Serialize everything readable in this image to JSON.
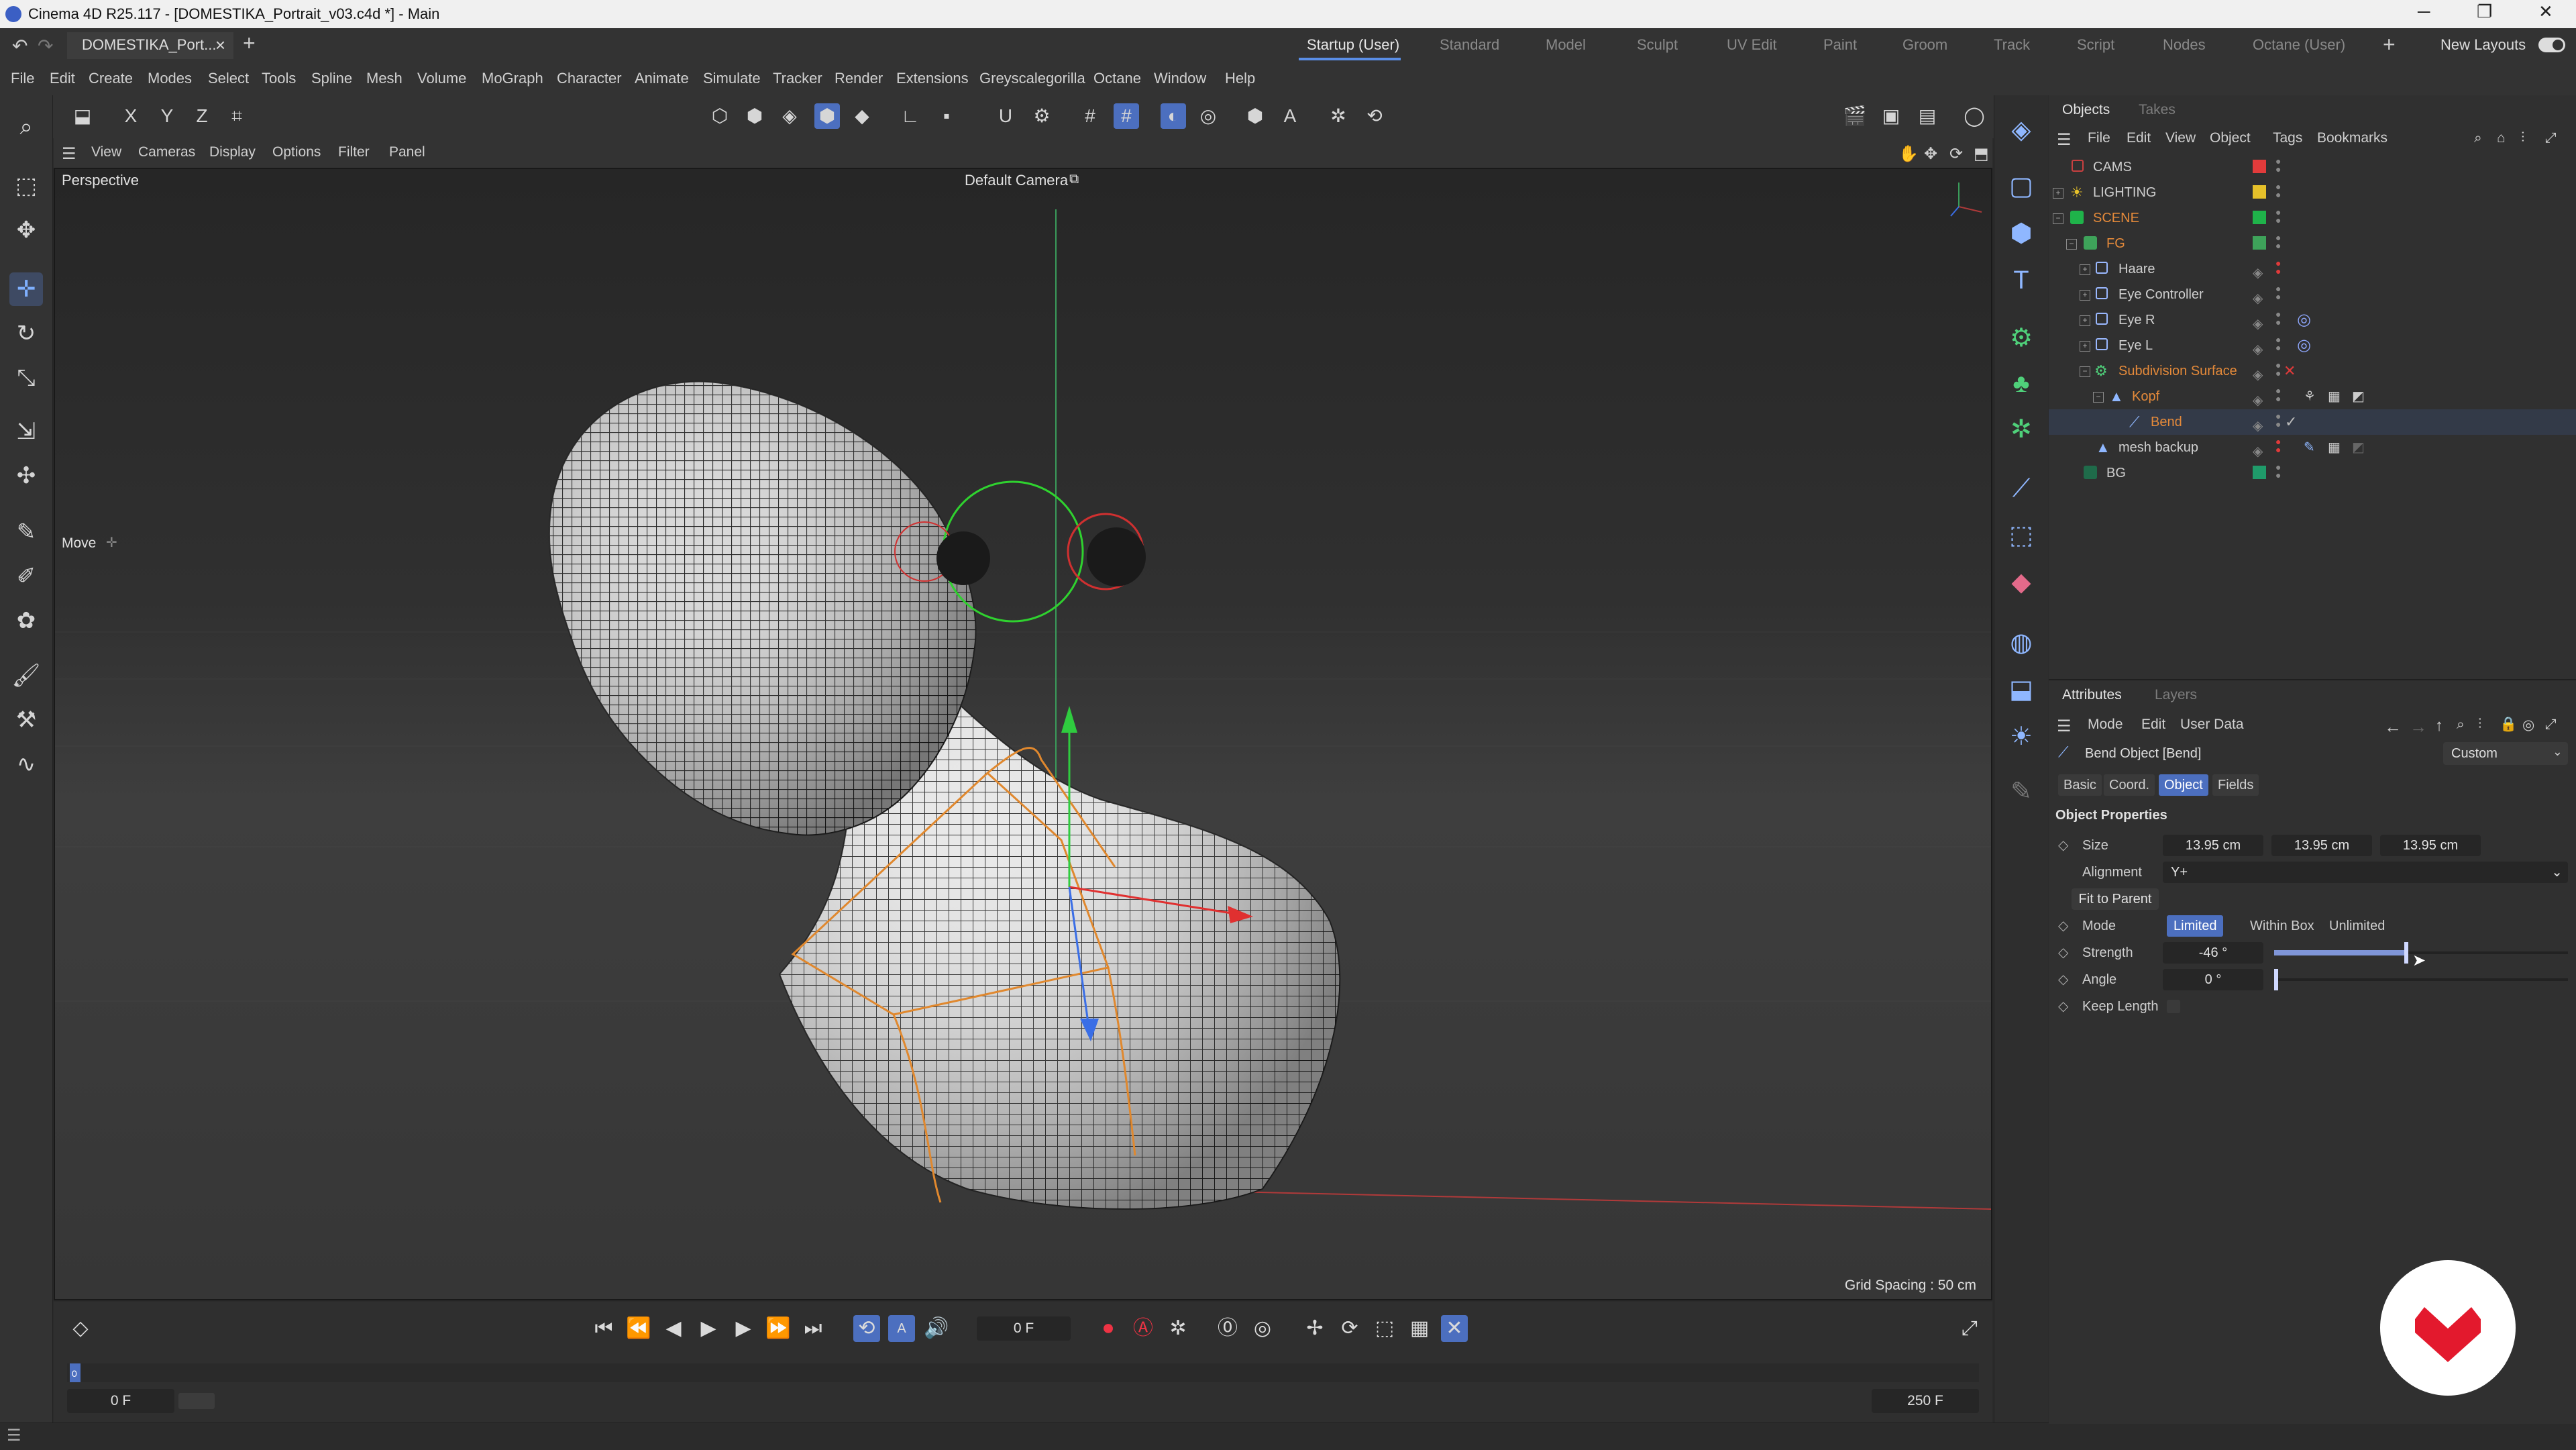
{
  "window": {
    "title": "Cinema 4D R25.117 - [DOMESTIKA_Portrait_v03.c4d *] - Main"
  },
  "doc_tab": {
    "label": "DOMESTIKA_Port...",
    "close": "×",
    "add": "+"
  },
  "layouts": [
    {
      "label": "Startup (User)",
      "active": true
    },
    {
      "label": "Standard"
    },
    {
      "label": "Model"
    },
    {
      "label": "Sculpt"
    },
    {
      "label": "UV Edit"
    },
    {
      "label": "Paint"
    },
    {
      "label": "Groom"
    },
    {
      "label": "Track"
    },
    {
      "label": "Script"
    },
    {
      "label": "Nodes"
    },
    {
      "label": "Octane (User)"
    }
  ],
  "new_layouts": "New Layouts",
  "menu": [
    "File",
    "Edit",
    "Create",
    "Modes",
    "Select",
    "Tools",
    "Spline",
    "Mesh",
    "Volume",
    "MoGraph",
    "Character",
    "Animate",
    "Simulate",
    "Tracker",
    "Render",
    "Extensions",
    "Greyscalegorilla",
    "Octane",
    "Window",
    "Help"
  ],
  "axis_lock": {
    "x": "X",
    "y": "Y",
    "z": "Z"
  },
  "viewport_menu": [
    "View",
    "Cameras",
    "Display",
    "Options",
    "Filter",
    "Panel"
  ],
  "viewport": {
    "label": "Perspective",
    "camera": "Default Camera",
    "grid_spacing": "Grid Spacing : 50 cm",
    "tool_hud": "Move"
  },
  "timeline": {
    "current_frame": "0 F",
    "start_frame": "0 F",
    "end_frame": "250 F",
    "playhead_marker": "0"
  },
  "objects_panel": {
    "tabs": [
      {
        "label": "Objects",
        "active": true
      },
      {
        "label": "Takes"
      }
    ],
    "menu": [
      "File",
      "Edit",
      "View",
      "Object",
      "Tags",
      "Bookmarks"
    ],
    "rows": [
      {
        "name": "CAMS",
        "color": "#e23b3b"
      },
      {
        "name": "LIGHTING",
        "color": "#e6c12a"
      },
      {
        "name": "SCENE",
        "color": "#1fb34a",
        "text_color": "#e58a3a"
      },
      {
        "name": "FG",
        "color": "#3ea35a",
        "text_color": "#e58a3a"
      },
      {
        "name": "Haare"
      },
      {
        "name": "Eye Controller"
      },
      {
        "name": "Eye R"
      },
      {
        "name": "Eye L"
      },
      {
        "name": "Subdivision Surface",
        "text_color": "#e58a3a"
      },
      {
        "name": "Kopf",
        "text_color": "#e58a3a"
      },
      {
        "name": "Bend",
        "text_color": "#e58a3a"
      },
      {
        "name": "mesh backup"
      },
      {
        "name": "BG",
        "color": "#1f9b6a"
      }
    ]
  },
  "attributes_panel": {
    "tabs": [
      {
        "label": "Attributes",
        "active": true
      },
      {
        "label": "Layers"
      }
    ],
    "menu": [
      "Mode",
      "Edit",
      "User Data"
    ],
    "object_title": "Bend Object [Bend]",
    "preset": "Custom",
    "sub_tabs": [
      {
        "label": "Basic"
      },
      {
        "label": "Coord."
      },
      {
        "label": "Object",
        "active": true
      },
      {
        "label": "Fields"
      }
    ],
    "section": "Object Properties",
    "size_label": "Size",
    "size": [
      "13.95 cm",
      "13.95 cm",
      "13.95 cm"
    ],
    "alignment_label": "Alignment",
    "alignment": "Y+",
    "fit_to_parent": "Fit to Parent",
    "mode_label": "Mode",
    "modes": [
      {
        "label": "Limited",
        "active": true
      },
      {
        "label": "Within Box"
      },
      {
        "label": "Unlimited"
      }
    ],
    "strength_label": "Strength",
    "strength": "-46 °",
    "strength_slider_fraction": 0.45,
    "angle_label": "Angle",
    "angle": "0 °",
    "keep_length_label": "Keep Length"
  },
  "colors": {
    "accent": "#4c6fbf",
    "highlight": "#e58a3a"
  }
}
